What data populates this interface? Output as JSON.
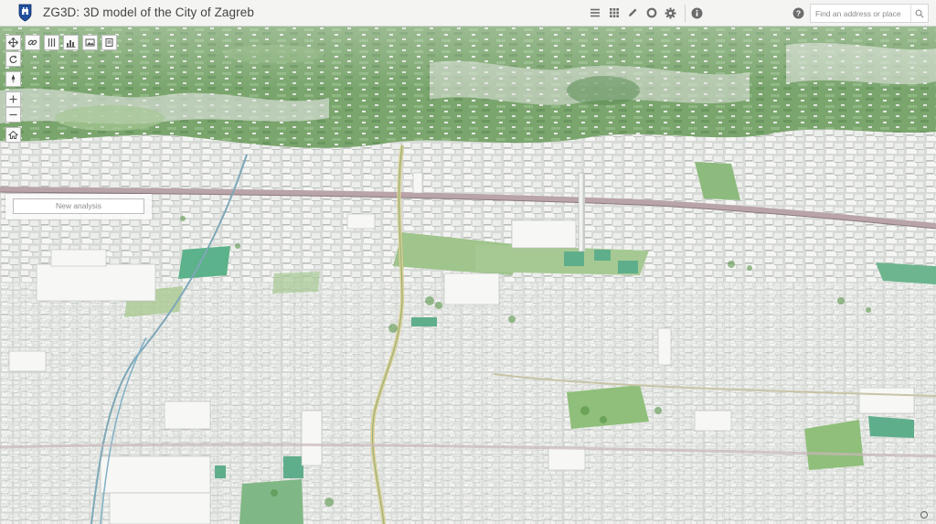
{
  "app": {
    "title": "ZG3D: 3D model of the City of Zagreb",
    "logo_icon": "zagreb-coat-of-arms-icon"
  },
  "header": {
    "buttons": [
      {
        "name": "legend-button",
        "icon": "list-icon"
      },
      {
        "name": "basemap-gallery-button",
        "icon": "grid-icon"
      },
      {
        "name": "measure-button",
        "icon": "pencil-icon"
      },
      {
        "name": "layers-button",
        "icon": "circle-icon"
      },
      {
        "name": "settings-button",
        "icon": "gear-icon"
      },
      {
        "name": "info-button",
        "icon": "info-icon"
      }
    ],
    "help_icon": "help-icon",
    "search": {
      "placeholder": "Find an address or place",
      "icon": "search-icon"
    }
  },
  "toolbar": {
    "horizontal": [
      {
        "name": "pan-tool",
        "icon": "move-icon"
      },
      {
        "name": "line-of-sight-tool",
        "icon": "link-icon"
      },
      {
        "name": "slice-tool",
        "icon": "columns-icon"
      },
      {
        "name": "elevation-profile-tool",
        "icon": "bar-chart-icon"
      },
      {
        "name": "image-tool",
        "icon": "picture-icon"
      },
      {
        "name": "book-tool",
        "icon": "book-icon"
      }
    ],
    "vertical": [
      {
        "name": "rotate-tool",
        "icon": "rotate-icon"
      },
      {
        "name": "compass-tool",
        "icon": "compass-icon"
      },
      {
        "name": "zoom-in-button",
        "icon": "plus-icon"
      },
      {
        "name": "zoom-out-button",
        "icon": "minus-icon"
      },
      {
        "name": "home-button",
        "icon": "home-icon"
      }
    ]
  },
  "analysis_panel": {
    "button_label": "New analysis"
  },
  "colors": {
    "header_bg": "#f4f4f2",
    "terrain_green": "#7fae72",
    "buildings": "#e9ebe8",
    "header_icon": "#6c6c6c"
  }
}
